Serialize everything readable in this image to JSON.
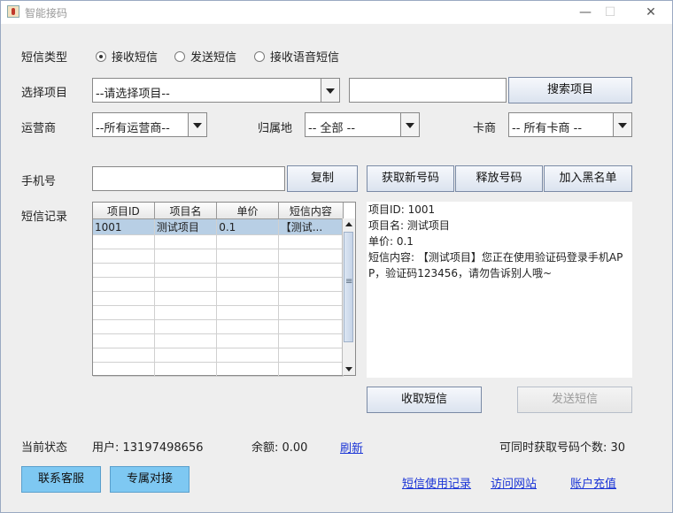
{
  "window": {
    "title": "智能接码",
    "minimize": "—",
    "maximize": "☐",
    "close": "✕"
  },
  "sms_type": {
    "label": "短信类型",
    "options": [
      "接收短信",
      "发送短信",
      "接收语音短信"
    ],
    "selected": "接收短信"
  },
  "project": {
    "label": "选择项目",
    "select_value": "--请选择项目--",
    "search_value": "",
    "search_button": "搜索项目"
  },
  "carrier": {
    "label": "运营商",
    "value": "--所有运营商--"
  },
  "region": {
    "label": "归属地",
    "value": "-- 全部 --"
  },
  "card": {
    "label": "卡商",
    "value": "-- 所有卡商 --"
  },
  "phone": {
    "label": "手机号",
    "value": "",
    "copy_button": "复制",
    "get_new_button": "获取新号码",
    "release_button": "释放号码",
    "blacklist_button": "加入黑名单"
  },
  "records": {
    "label": "短信记录",
    "columns": [
      "项目ID",
      "项目名",
      "单价",
      "短信内容"
    ],
    "rows": [
      [
        "1001",
        "测试项目",
        "0.1",
        "【测试..."
      ],
      [
        "",
        "",
        "",
        ""
      ],
      [
        "",
        "",
        "",
        ""
      ],
      [
        "",
        "",
        "",
        ""
      ],
      [
        "",
        "",
        "",
        ""
      ],
      [
        "",
        "",
        "",
        ""
      ],
      [
        "",
        "",
        "",
        ""
      ],
      [
        "",
        "",
        "",
        ""
      ],
      [
        "",
        "",
        "",
        ""
      ],
      [
        "",
        "",
        "",
        ""
      ],
      [
        "",
        "",
        "",
        ""
      ]
    ],
    "selected_row": 0
  },
  "detail": {
    "lines": [
      "项目ID: 1001",
      "项目名: 测试项目",
      "单价: 0.1",
      "短信内容: 【测试项目】您正在使用验证码登录手机APP，验证码123456，请勿告诉别人哦~"
    ]
  },
  "actions": {
    "receive_button": "收取短信",
    "send_button": "发送短信"
  },
  "status": {
    "label": "当前状态",
    "user": "用户: 13197498656",
    "balance": "余额: 0.00",
    "refresh": "刷新",
    "concurrent": "可同时获取号码个数: 30"
  },
  "footer": {
    "contact_button": "联系客服",
    "dedicated_button": "专属对接",
    "links": [
      "短信使用记录",
      "访问网站",
      "账户充值"
    ]
  },
  "colors": {
    "accent_button": "#7ec8f2",
    "link": "#1a34d6",
    "selected_row": "#b8cfe5"
  }
}
